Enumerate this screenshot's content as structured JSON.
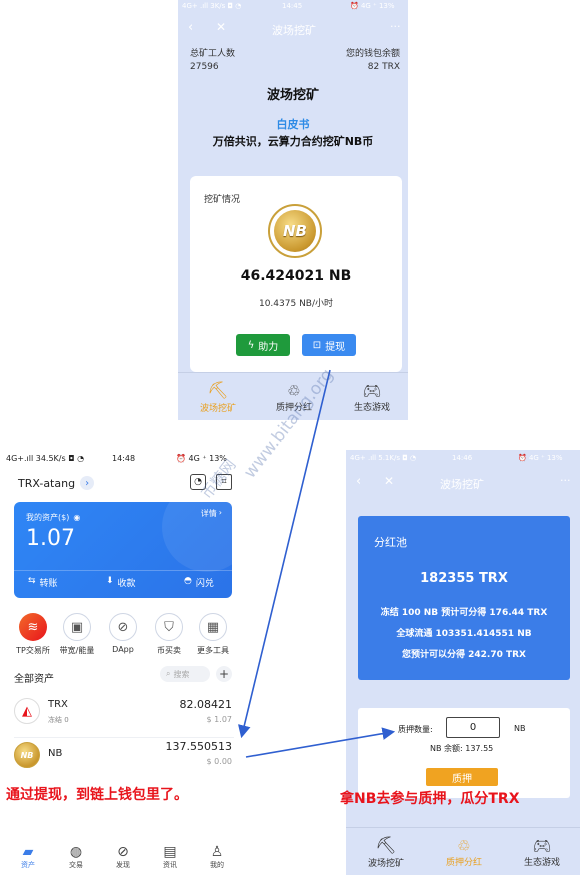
{
  "mining": {
    "status": {
      "left": "4G+ .ıll  3K/s ◘ ◔",
      "time": "14:45",
      "right": "⏰ 4G ⁺ 13%"
    },
    "title": "波场挖矿",
    "total_miners_label": "总矿工人数",
    "total_miners": "27596",
    "wallet_balance_label": "您的钱包余额",
    "wallet_balance": "82 TRX",
    "heading": "波场挖矿",
    "whitepaper": "白皮书",
    "slogan": "万倍共识，云算力合约挖矿NB币",
    "card_label": "挖矿情况",
    "coin_text": "NB",
    "amount": "46.424021 NB",
    "rate": "10.4375 NB/小时",
    "help_btn": "助力",
    "withdraw_btn": "提现",
    "tabs": [
      "波场挖矿",
      "质押分红",
      "生态游戏"
    ]
  },
  "wallet": {
    "status": {
      "left": "4G+.ıll  34.5K/s ◘ ◔",
      "time": "14:48",
      "right": "⏰ 4G ⁺ 13%"
    },
    "account": "TRX-atang",
    "asset_label": "我的资产($)",
    "detail": "详情",
    "asset_value": "1.07",
    "transfer": "转账",
    "receive": "收款",
    "flash": "闪兑",
    "quick": [
      "TP交易所",
      "带宽/能量",
      "DApp",
      "币买卖",
      "更多工具"
    ],
    "all_assets": "全部资产",
    "search_placeholder": "搜索",
    "tokens": [
      {
        "name": "TRX",
        "sub": "冻结 0",
        "amount": "82.08421",
        "usd": "$ 1.07"
      },
      {
        "name": "NB",
        "sub": "",
        "amount": "137.550513",
        "usd": "$ 0.00"
      }
    ],
    "nav": [
      "资产",
      "交易",
      "发现",
      "资讯",
      "我的"
    ]
  },
  "stake": {
    "status": {
      "left": "4G+ .ıll  5.1K/s ◘ ◔",
      "time": "14:46",
      "right": "⏰ 4G ⁺ 13%"
    },
    "title": "波场挖矿",
    "pool_title": "分红池",
    "pool_amount": "182355 TRX",
    "line1": "冻结 100 NB 预计可分得 176.44 TRX",
    "line2": "全球流通 103351.414551 NB",
    "line3": "您预计可以分得 242.70 TRX",
    "qty_label": "质押数量:",
    "qty_value": "0",
    "unit": "NB",
    "balance": "NB 余额: 137.55",
    "stake_btn": "质押",
    "tabs": [
      "波场挖矿",
      "质押分红",
      "生态游戏"
    ]
  },
  "annotations": {
    "left": "通过提现，到链上钱包里了。",
    "right": "拿NB去参与质押，瓜分TRX",
    "watermark1": "www.bitang.org",
    "watermark2": "币糖网"
  },
  "colors": {
    "accent": "#3b7de8",
    "green": "#1f9a3c",
    "red": "#e8141c",
    "gold": "#f0a321"
  }
}
